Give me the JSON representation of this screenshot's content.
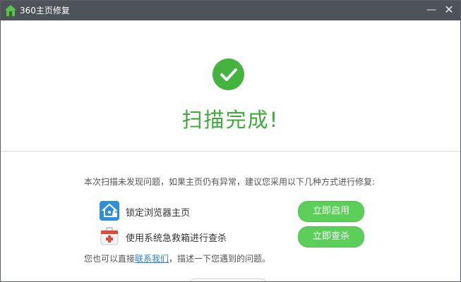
{
  "window": {
    "title": "360主页修复",
    "minimize_glyph": "—",
    "close_glyph": "✕",
    "app_icon": "house-icon",
    "accent_color": "#44b33f"
  },
  "status": {
    "icon": "check-icon",
    "title": "扫描完成!"
  },
  "description": "本次扫描未发现问题，如果主页仍有异常，建议您采用以下几种方式进行修复:",
  "options": [
    {
      "icon": "locked-home-icon",
      "label": "锁定浏览器主页",
      "button": "立即启用"
    },
    {
      "icon": "first-aid-kit-icon",
      "label": "使用系统急救箱进行查杀",
      "button": "立即查杀"
    }
  ],
  "contact": {
    "prefix": "您也可以直接",
    "link": "联系我们",
    "suffix": "，描述一下您遇到的问题。"
  }
}
